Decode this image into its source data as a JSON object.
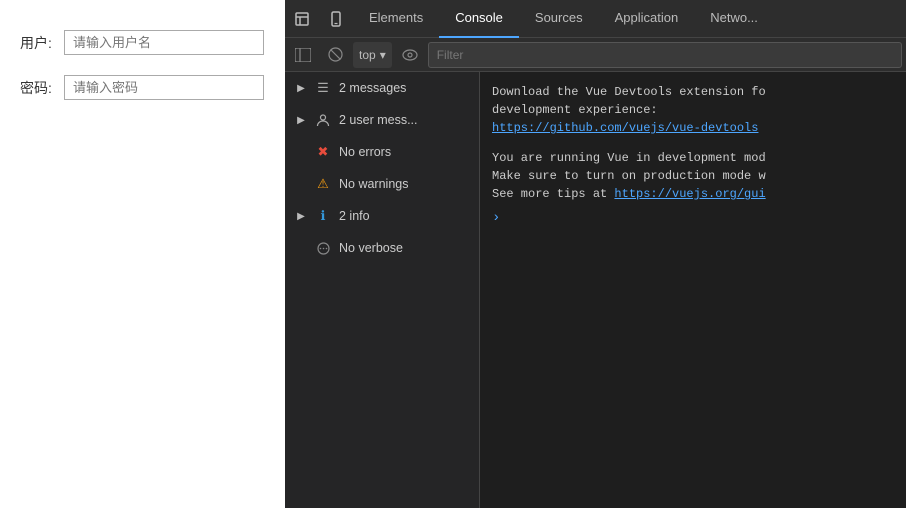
{
  "page": {
    "form": {
      "username_label": "用户:",
      "username_placeholder": "请输入用户名",
      "password_label": "密码:",
      "password_placeholder": "请输入密码"
    }
  },
  "devtools": {
    "tabs": [
      {
        "id": "elements",
        "label": "Elements",
        "active": false
      },
      {
        "id": "console",
        "label": "Console",
        "active": true
      },
      {
        "id": "sources",
        "label": "Sources",
        "active": false
      },
      {
        "id": "application",
        "label": "Application",
        "active": false
      },
      {
        "id": "network",
        "label": "Netwo...",
        "active": false
      }
    ],
    "toolbar": {
      "context": "top",
      "filter_placeholder": "Filter"
    },
    "sidebar": {
      "items": [
        {
          "id": "messages",
          "label": "2 messages",
          "icon": "list",
          "arrow": true,
          "active": false
        },
        {
          "id": "user-messages",
          "label": "2 user mess...",
          "icon": "user",
          "arrow": true,
          "active": false
        },
        {
          "id": "errors",
          "label": "No errors",
          "icon": "error",
          "arrow": false,
          "active": false
        },
        {
          "id": "warnings",
          "label": "No warnings",
          "icon": "warning",
          "arrow": false,
          "active": false
        },
        {
          "id": "info",
          "label": "2 info",
          "icon": "info",
          "arrow": true,
          "active": false
        },
        {
          "id": "verbose",
          "label": "No verbose",
          "icon": "verbose",
          "arrow": false,
          "active": false
        }
      ]
    },
    "console_lines": [
      {
        "text": "Download the Vue Devtools extension fo",
        "type": "normal"
      },
      {
        "text": "development experience:",
        "type": "normal"
      },
      {
        "text": "https://github.com/vuejs/vue-devtools",
        "type": "link"
      },
      {
        "text": "",
        "type": "empty"
      },
      {
        "text": "You are running Vue in development mod",
        "type": "normal"
      },
      {
        "text": "Make sure to turn on production mode w",
        "type": "normal"
      },
      {
        "text": "See more tips at https://vuejs.org/gui",
        "type": "mixed"
      }
    ]
  }
}
